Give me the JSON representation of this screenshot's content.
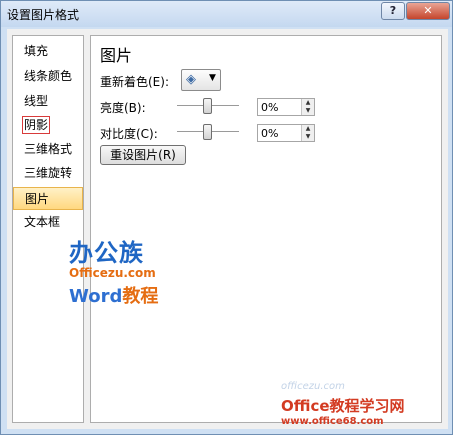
{
  "window": {
    "title": "设置图片格式",
    "help": "?",
    "close": "✕"
  },
  "nav": [
    {
      "label": "填充"
    },
    {
      "label": "线条颜色"
    },
    {
      "label": "线型"
    },
    {
      "label": "阴影"
    },
    {
      "label": "三维格式"
    },
    {
      "label": "三维旋转"
    },
    {
      "label": "图片"
    },
    {
      "label": "文本框"
    }
  ],
  "panel": {
    "title": "图片",
    "recolor_label": "重新着色(E):",
    "brightness_label": "亮度(B):",
    "brightness_value": "0%",
    "contrast_label": "对比度(C):",
    "contrast_value": "0%",
    "reset_label": "重设图片(R)"
  },
  "watermark": {
    "logo_big": "办公族",
    "logo_site": "Officezu.com",
    "logo_word_latin": "Word",
    "logo_word_cn": "教程",
    "faint": "officezu.com",
    "brand": "Office教程学习网",
    "url": "www.office68.com"
  },
  "colors": {
    "selected_bg": "#ffd880",
    "marker": "#d83a3a",
    "close_red": "#c5452c"
  }
}
